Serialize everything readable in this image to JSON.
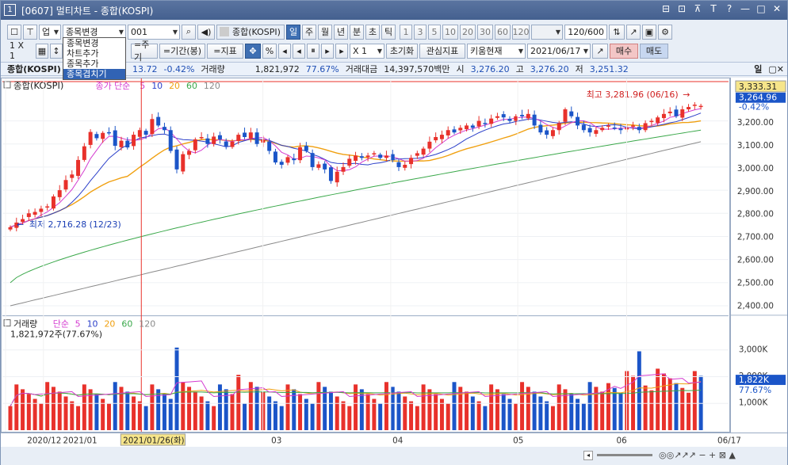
{
  "window": {
    "number": "1",
    "title": "[0607] 멀티차트 - 종합(KOSPI)",
    "controls": [
      "⊟",
      "⊡",
      "⊼",
      "T",
      "?",
      "—",
      "□",
      "✕"
    ]
  },
  "toolbar1": {
    "mode_value": "업",
    "action_select": "종목변경",
    "code_value": "001",
    "stock_name": "종합(KOSPI)",
    "periods": [
      "일",
      "주",
      "월",
      "년",
      "분",
      "초",
      "틱"
    ],
    "selected_period": "일",
    "intervals": [
      "1",
      "3",
      "5",
      "10",
      "20",
      "30",
      "60",
      "120"
    ],
    "count_value": "120",
    "count_total": "/600"
  },
  "dropdown_menu": {
    "items": [
      "종목변경",
      "차트추가",
      "종목추가",
      "종목겹치기"
    ],
    "highlighted_index": 3
  },
  "toolbar2": {
    "layout": "1 X 1",
    "period_btn": "=주기",
    "range_btn": "=기간(봉)",
    "indicator_btn": "=지표",
    "percent_btn": "%",
    "zoom_value": "X 1",
    "reset_btn": "초기화",
    "watch_btn": "관심지표",
    "current_btn": "키움현재",
    "date_value": "2021/06/17",
    "buy_btn": "매수",
    "sell_btn": "매도"
  },
  "info_bar": {
    "name": "종합(KOSPI)",
    "change": "13.72",
    "change_pct": "-0.42%",
    "volume_label": "거래량",
    "volume": "1,821,972",
    "volume_pct": "77.67%",
    "amount_label": "거래대금",
    "amount": "14,397,570백만",
    "open_label": "시",
    "open": "3,276.20",
    "high_label": "고",
    "high": "3,276.20",
    "low_label": "저",
    "low": "3,251.32",
    "right_label": "일"
  },
  "chart_data": {
    "type": "candlestick",
    "title": "종합(KOSPI)",
    "ma_label": "종가 단순",
    "ma_periods": [
      "5",
      "10",
      "20",
      "60",
      "120"
    ],
    "y_ticks": [
      "3,200.00",
      "3,100.00",
      "3,000.00",
      "2,900.00",
      "2,800.00",
      "2,700.00",
      "2,600.00",
      "2,500.00",
      "2,400.00"
    ],
    "ylim": [
      2360,
      3370
    ],
    "last_price": "3,264.96",
    "last_change_pct": "-0.42%",
    "top_value": "3,333.31",
    "max_annotation": "최고 3,281.96 (06/16)",
    "min_annotation": "최저 2,716.28 (12/23)",
    "x_labels": [
      "2020/12",
      "2021/01",
      "03",
      "04",
      "05",
      "06"
    ],
    "cursor_label": "2021/01/26(화)",
    "last_x_label": "06/17",
    "closes": [
      2740,
      2760,
      2775,
      2800,
      2806,
      2820,
      2830,
      2873,
      2900,
      2944,
      2968,
      3031,
      3090,
      3152,
      3125,
      3148,
      3150,
      3092,
      3114,
      3085,
      3140,
      3160,
      3140,
      3208,
      3180,
      3160,
      3070,
      2990,
      3056,
      3070,
      3120,
      3130,
      3100,
      3132,
      3120,
      3090,
      3110,
      3140,
      3130,
      3150,
      3100,
      3120,
      3070,
      3020,
      3010,
      3043,
      3030,
      3086,
      3070,
      3000,
      3012,
      2990,
      2940,
      2980,
      3000,
      3036,
      3050,
      3040,
      3050,
      3060,
      3040,
      3050,
      3030,
      3000,
      3010,
      3040,
      3060,
      3080,
      3110,
      3130,
      3140,
      3160,
      3150,
      3170,
      3180,
      3170,
      3200,
      3190,
      3210,
      3220,
      3215,
      3200,
      3220,
      3220,
      3230,
      3180,
      3150,
      3140,
      3160,
      3190,
      3250,
      3220,
      3180,
      3160,
      3150,
      3160,
      3170,
      3180,
      3170,
      3160,
      3170,
      3180,
      3160,
      3190,
      3200,
      3215,
      3230,
      3240,
      3220,
      3250,
      3260,
      3270,
      3265
    ],
    "volume_title": "거래량",
    "volume_ma_label": "단순",
    "volume_value": "1,821,972주(77.67%)",
    "volume_y_ticks": [
      "3,000K",
      "2,000K",
      "1,000K"
    ],
    "volume_last": "1,822K",
    "volume_last_pct": "77.67%"
  },
  "colors": {
    "up": "#e8312b",
    "down": "#1b55c8",
    "ma5": "#d43bd0",
    "ma10": "#2b3fc9",
    "ma20": "#f0a010",
    "ma60": "#3aa84a",
    "ma120": "#8a8a8a"
  }
}
